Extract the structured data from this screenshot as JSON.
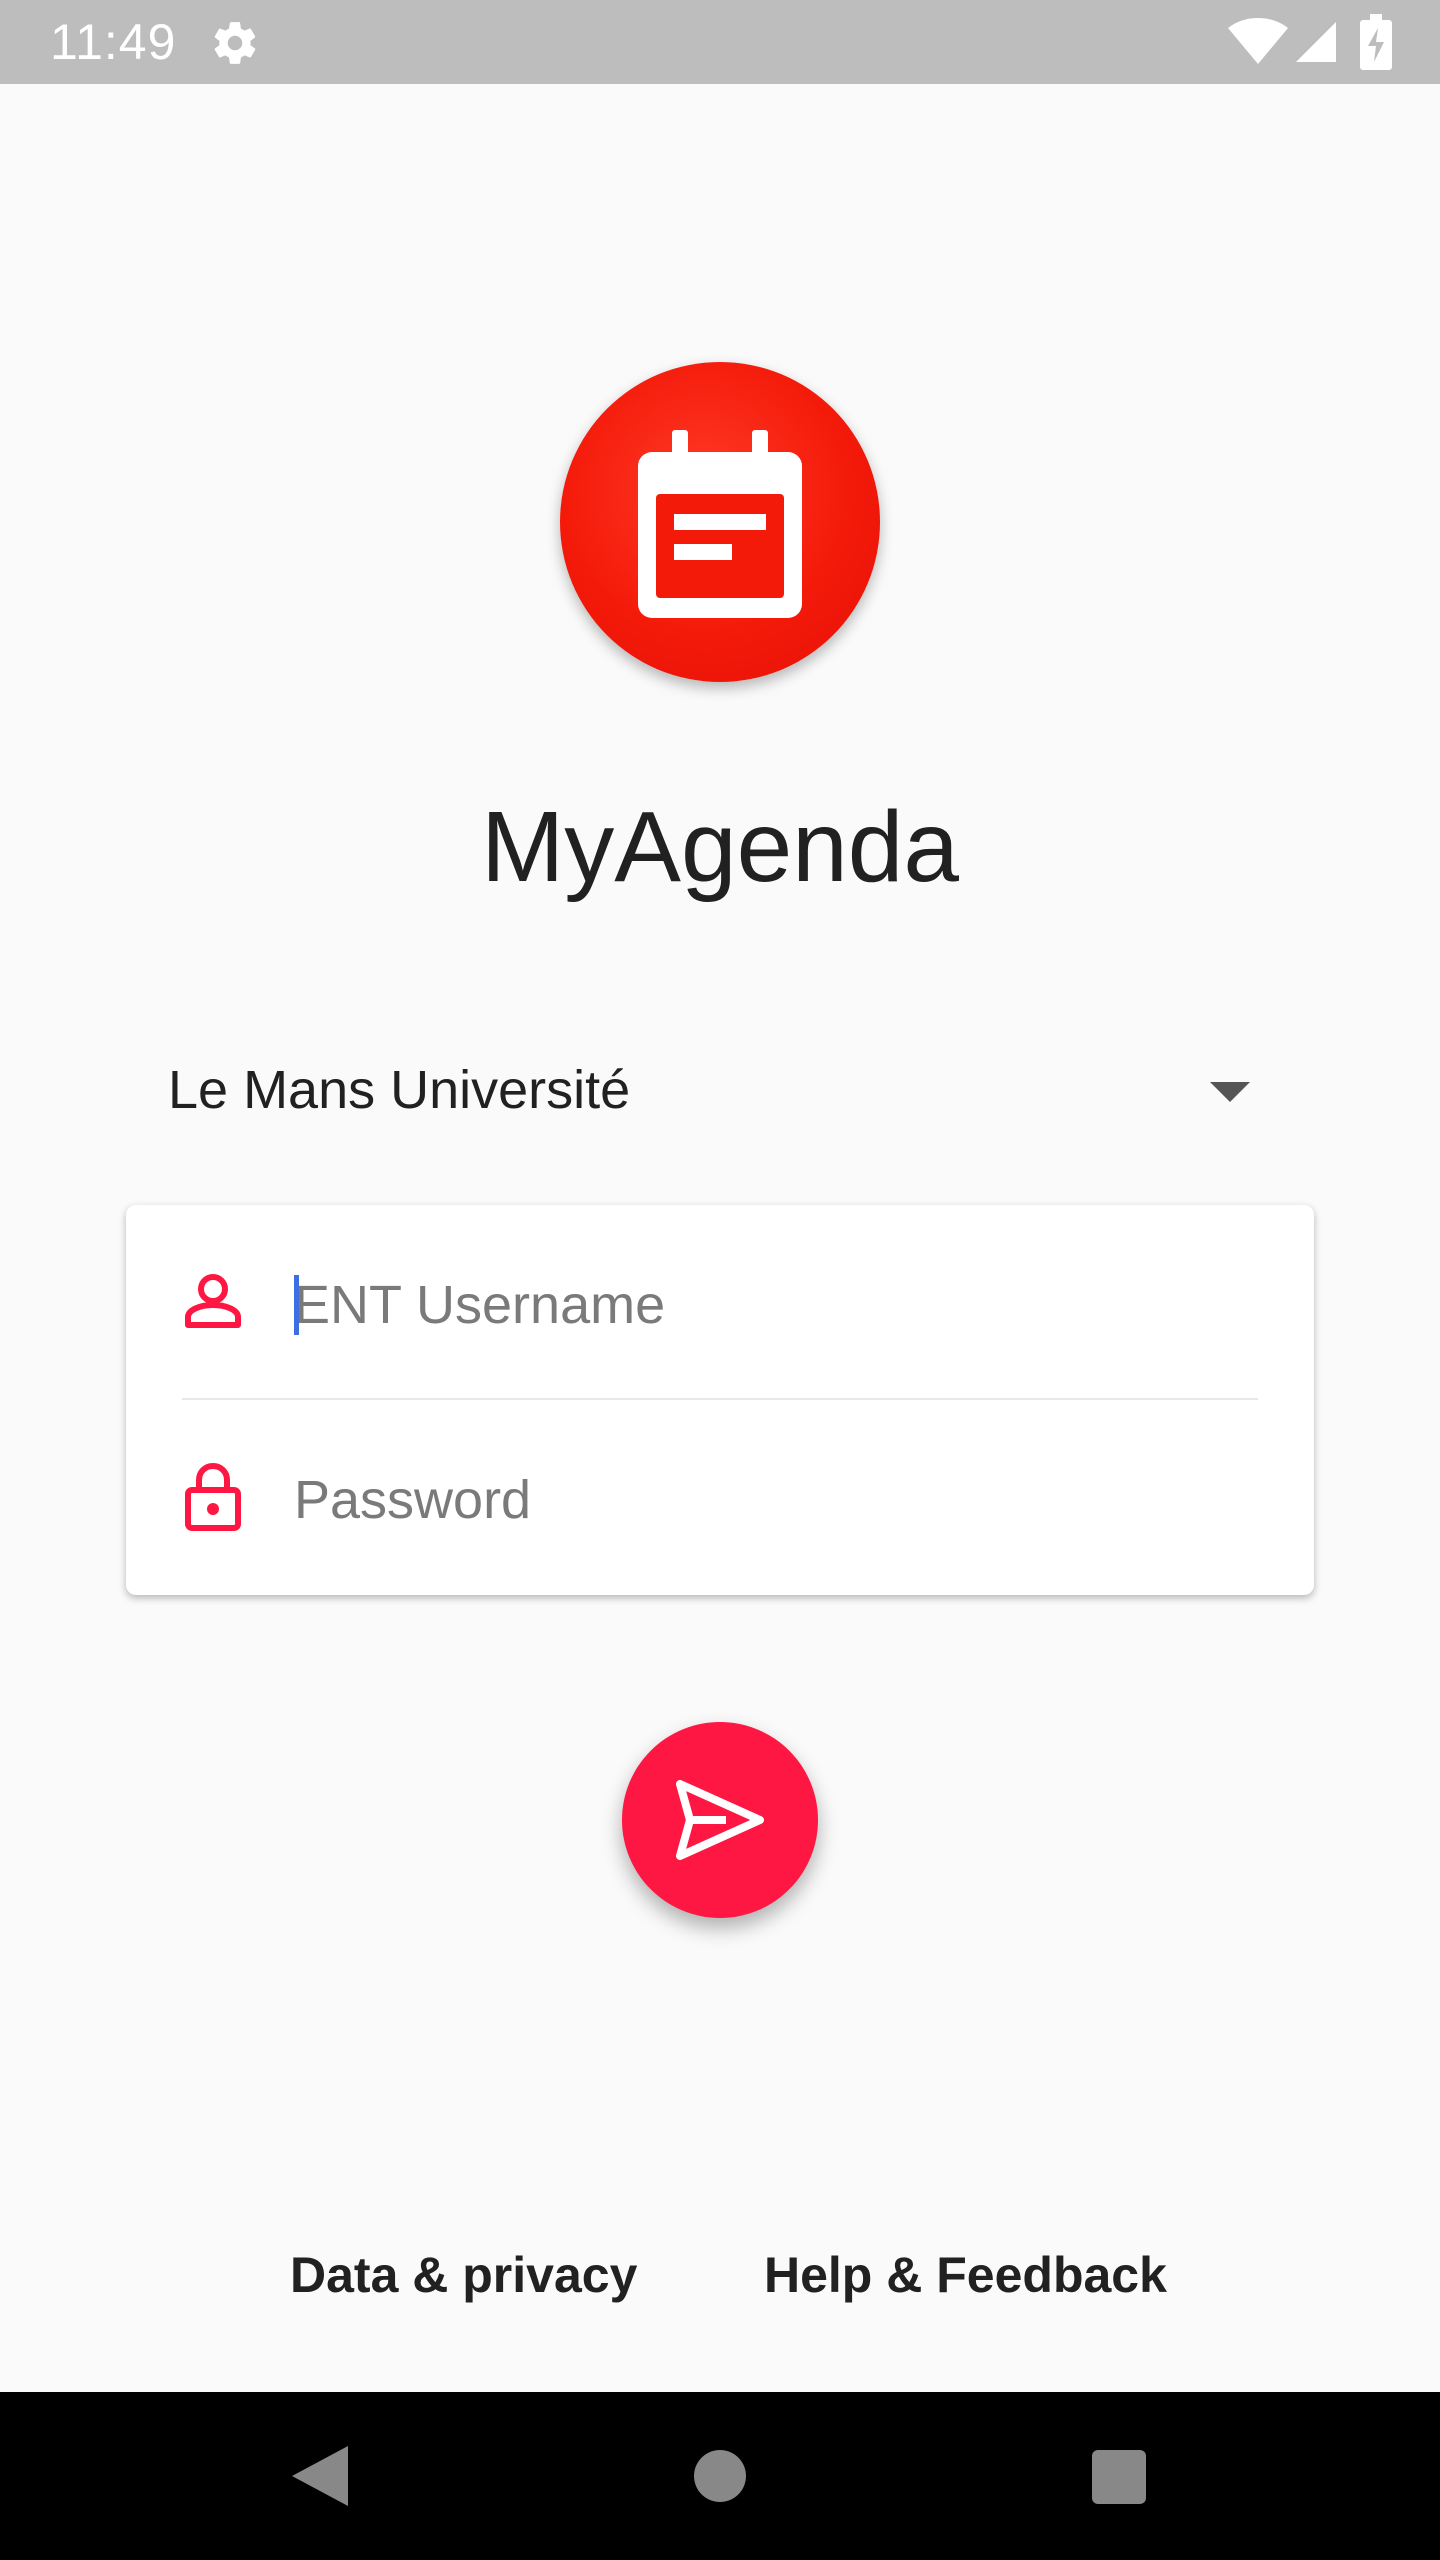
{
  "status_bar": {
    "time": "11:49",
    "icons": [
      "settings-gear-icon",
      "wifi-icon",
      "cell-signal-icon",
      "battery-charging-icon"
    ]
  },
  "app": {
    "title": "MyAgenda",
    "logo_icon": "calendar-icon",
    "brand_color": "#f41a0a",
    "accent_color": "#ff1744"
  },
  "login": {
    "university": "Le Mans Université",
    "username_placeholder": "ENT Username",
    "username_value": "",
    "password_placeholder": "Password",
    "password_value": "",
    "username_icon": "person-icon",
    "password_icon": "lock-icon",
    "submit_icon": "send-icon"
  },
  "footer": {
    "privacy_label": "Data & privacy",
    "help_label": "Help & Feedback"
  },
  "nav_bar": {
    "buttons": [
      "back-icon",
      "home-icon",
      "recents-icon"
    ]
  }
}
